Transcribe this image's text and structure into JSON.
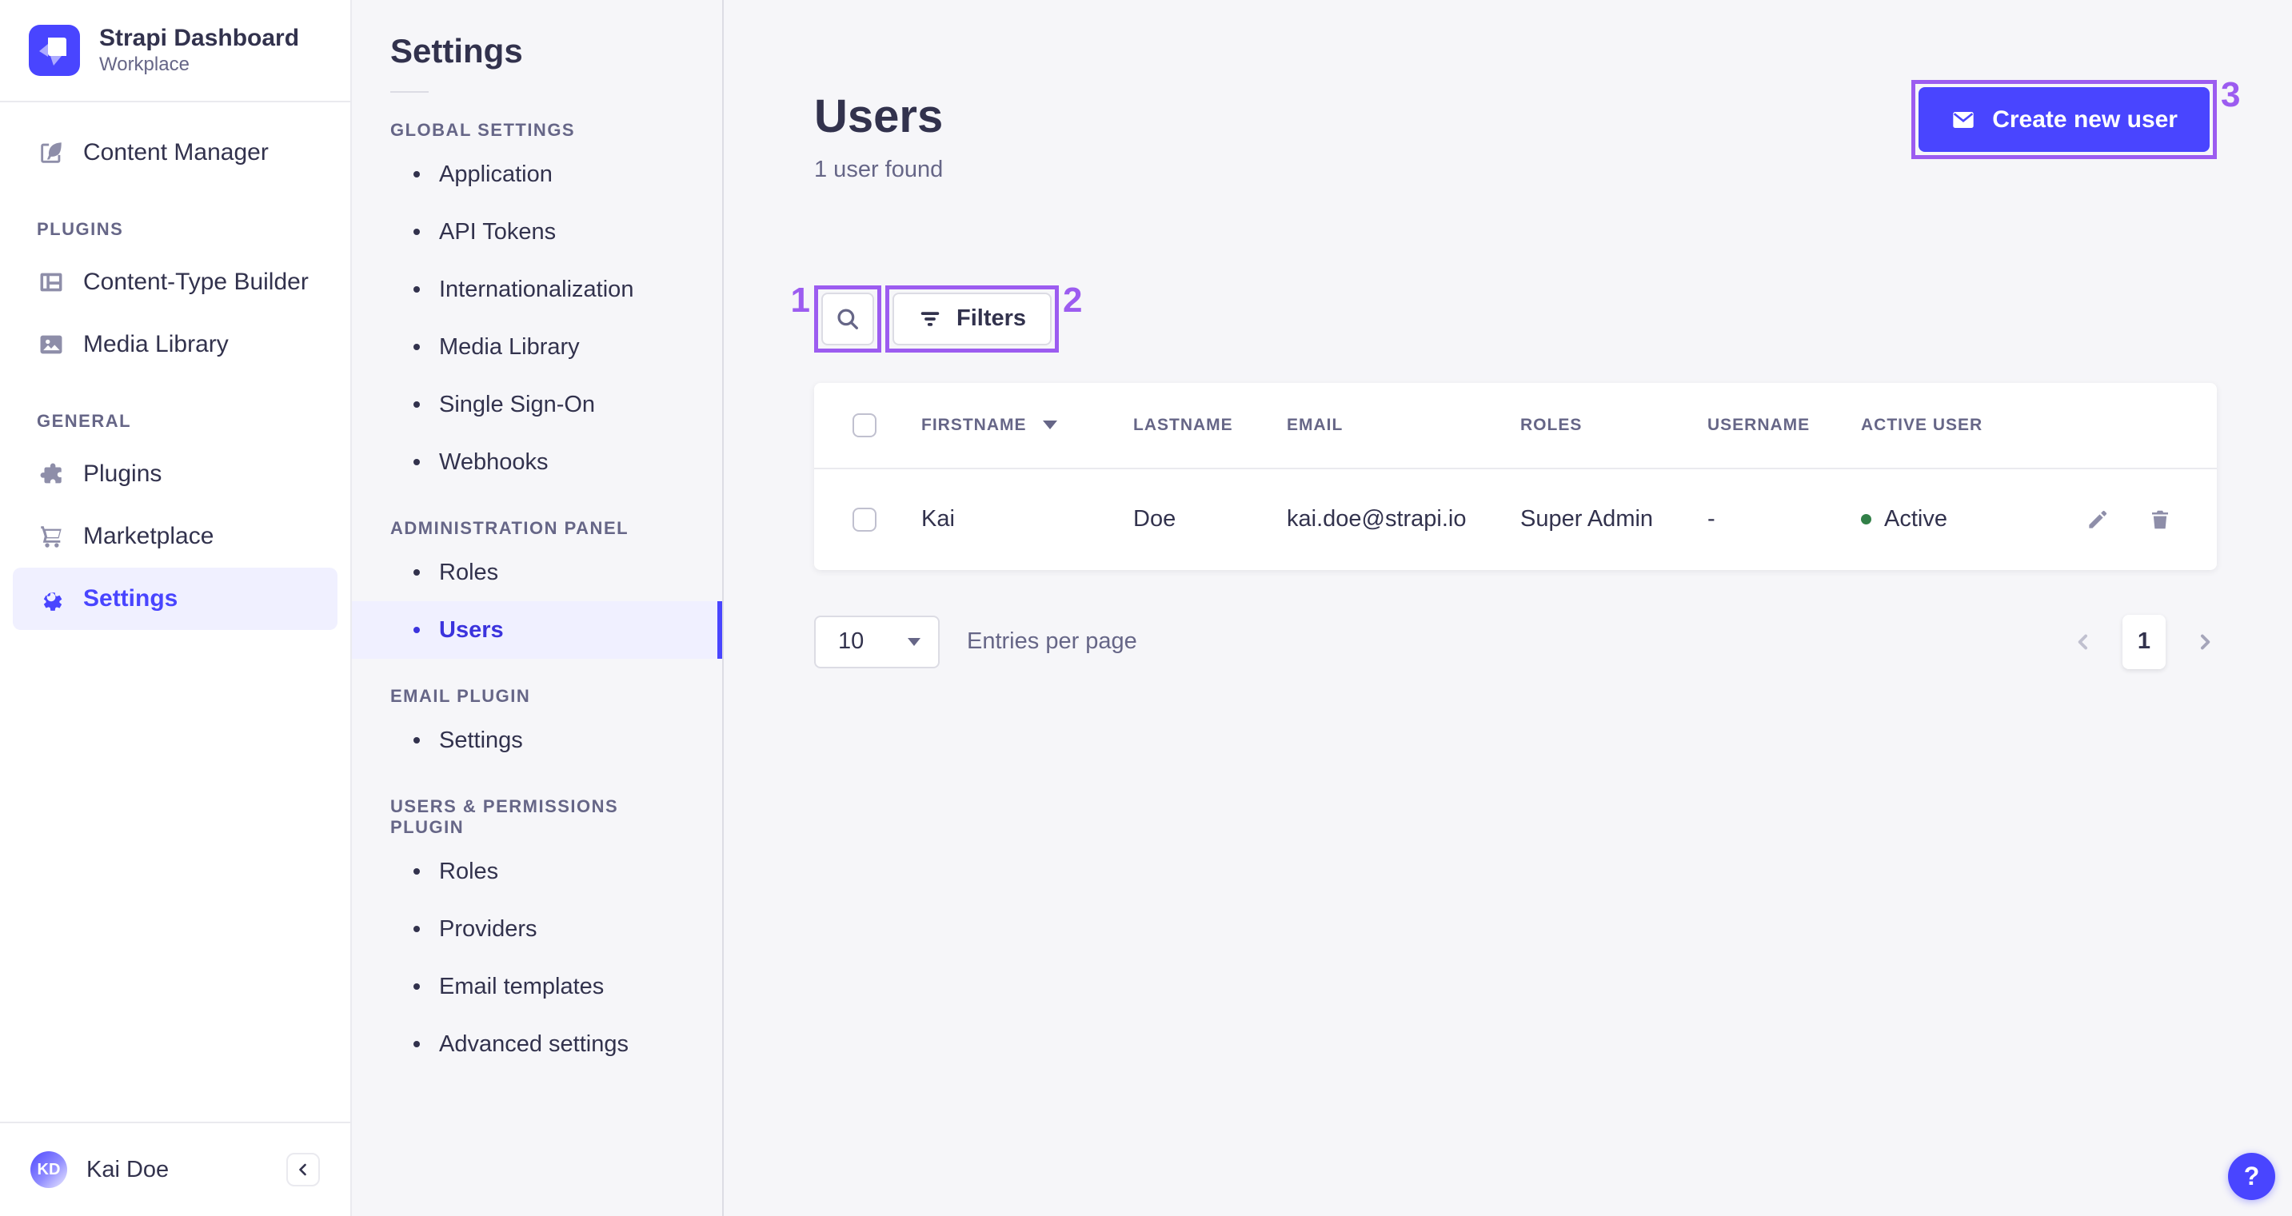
{
  "colors": {
    "primary": "#4945ff",
    "annotation_purple": "#9c5cf0",
    "success_green": "#328048",
    "selected_bg": "#f0f0ff",
    "page_bg": "#f6f6f9"
  },
  "brand": {
    "title": "Strapi Dashboard",
    "subtitle": "Workplace",
    "logo_icon": "strapi-logo-icon"
  },
  "sidebar": {
    "content_manager_label": "Content Manager",
    "sections": [
      {
        "label": "PLUGINS",
        "items": [
          {
            "label": "Content-Type Builder",
            "icon": "content-type-builder-icon"
          },
          {
            "label": "Media Library",
            "icon": "media-library-icon"
          }
        ]
      },
      {
        "label": "GENERAL",
        "items": [
          {
            "label": "Plugins",
            "icon": "plugins-icon"
          },
          {
            "label": "Marketplace",
            "icon": "marketplace-icon"
          },
          {
            "label": "Settings",
            "icon": "settings-icon",
            "selected": true
          }
        ]
      }
    ],
    "footer": {
      "initials": "KD",
      "name": "Kai Doe",
      "collapse_icon": "chevron-left-icon"
    }
  },
  "subnav": {
    "title": "Settings",
    "sections": [
      {
        "label": "GLOBAL SETTINGS",
        "items": [
          "Application",
          "API Tokens",
          "Internationalization",
          "Media Library",
          "Single Sign-On",
          "Webhooks"
        ]
      },
      {
        "label": "ADMINISTRATION PANEL",
        "items": [
          "Roles",
          "Users"
        ],
        "selected_item": "Users"
      },
      {
        "label": "EMAIL PLUGIN",
        "items": [
          "Settings"
        ]
      },
      {
        "label": "USERS & PERMISSIONS PLUGIN",
        "items": [
          "Roles",
          "Providers",
          "Email templates",
          "Advanced settings"
        ]
      }
    ]
  },
  "main": {
    "title": "Users",
    "subtitle": "1 user found",
    "create_button_label": "Create new user",
    "filters_button_label": "Filters",
    "table": {
      "headers": [
        "FIRSTNAME",
        "LASTNAME",
        "EMAIL",
        "ROLES",
        "USERNAME",
        "ACTIVE USER"
      ],
      "rows": [
        {
          "firstname": "Kai",
          "lastname": "Doe",
          "email": "kai.doe@strapi.io",
          "roles": "Super Admin",
          "username": "-",
          "active_status": "Active"
        }
      ]
    },
    "pagination": {
      "entries_per_page": "10",
      "entries_label": "Entries per page",
      "current_page": "1"
    }
  },
  "annotations": {
    "labels": [
      "1",
      "2",
      "3"
    ]
  },
  "help_button_label": "?"
}
